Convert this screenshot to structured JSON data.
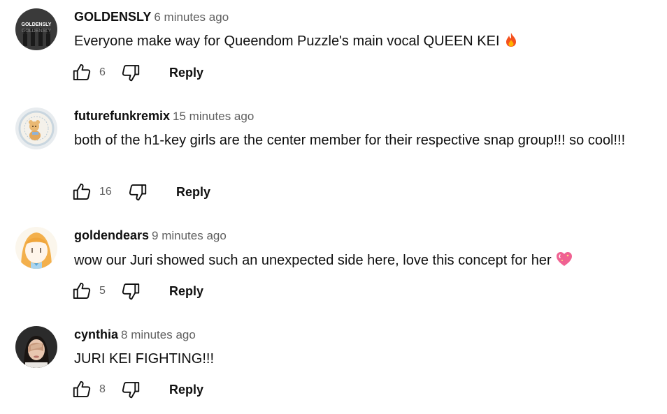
{
  "comments": [
    {
      "author": "GOLDENSLY",
      "time": "6 minutes ago",
      "text": "Everyone make way for Queendom Puzzle's main vocal QUEEN KEI",
      "emoji": "fire-emoji",
      "likes": "6",
      "reply_label": "Reply",
      "avatar_text": "GOLDENSLY"
    },
    {
      "author": "futurefunkremix",
      "time": "15 minutes ago",
      "text": "both of the h1-key girls are the center member for their respective snap group!!! so cool!!!",
      "likes": "16",
      "reply_label": "Reply"
    },
    {
      "author": "goldendears",
      "time": "9 minutes ago",
      "text": "wow our Juri showed such an unexpected side here, love this concept for her",
      "emoji": "sparkling-heart-emoji",
      "likes": "5",
      "reply_label": "Reply"
    },
    {
      "author": "cynthia",
      "time": "8 minutes ago",
      "text": "JURI KEI FIGHTING!!!",
      "likes": "8",
      "reply_label": "Reply"
    }
  ],
  "colors": {
    "text": "#0f0f0f",
    "secondary": "#606060",
    "fire": "#f4511e",
    "heart": "#f06292"
  },
  "icons": {
    "like": "thumbs-up-icon",
    "dislike": "thumbs-down-icon"
  }
}
